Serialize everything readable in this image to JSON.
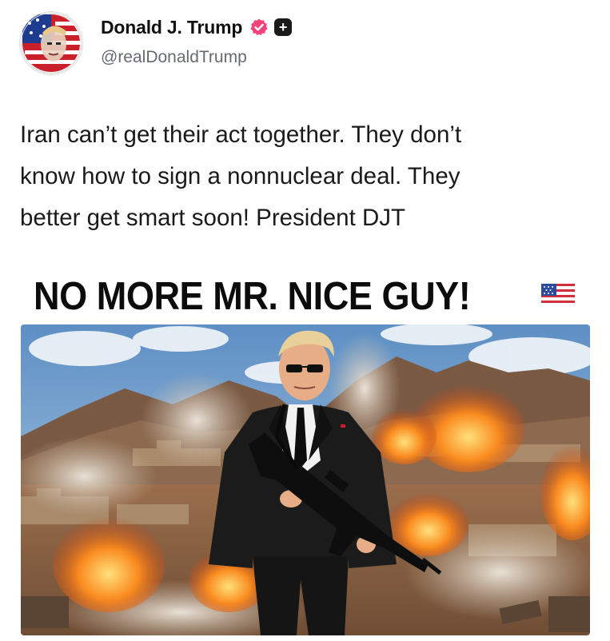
{
  "post": {
    "author": {
      "display_name": "Donald J. Trump",
      "handle": "@realDonaldTrump",
      "avatar_icon": "flag-portrait-avatar",
      "verified_icon": "verified-badge-icon",
      "verified_color": "#f0447a",
      "plus_badge": "+"
    },
    "body_lines": [
      "Iran can’t get their act together. They don’t",
      "know how to sign a nonnuclear deal. They",
      "better get smart soon! President DJT"
    ],
    "image": {
      "headline": "NO MORE MR. NICE GUY!",
      "headline_emoji": "us-flag-emoji",
      "scene": "man-in-black-suit-with-rifle-amid-explosions"
    }
  },
  "colors": {
    "text": "#1a1a1a",
    "handle": "#666a70",
    "sky": "#7fa8d0",
    "fire": "#f26b1d"
  }
}
